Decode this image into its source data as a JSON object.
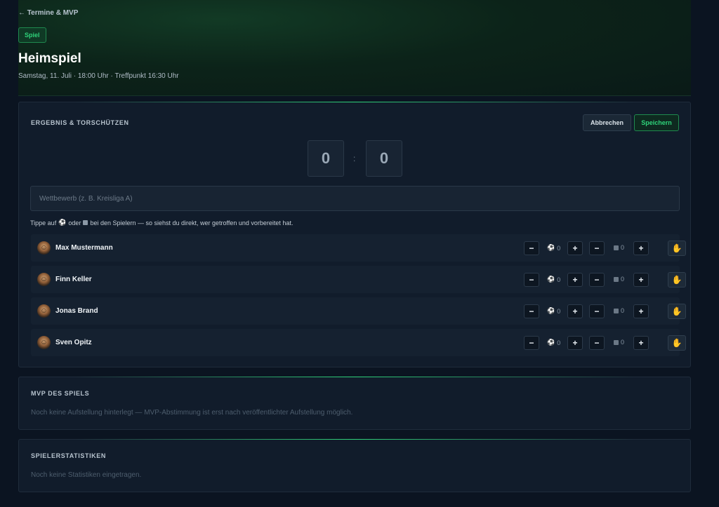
{
  "header": {
    "back_label": "← Termine & MVP",
    "badge": "Spiel",
    "title": "Heimspiel",
    "subtitle": "Samstag, 11. Juli · 18:00 Uhr · Treffpunkt 16:30 Uhr"
  },
  "result": {
    "section_title": "ERGEBNIS & TORSCHÜTZEN",
    "cancel_label": "Abbrechen",
    "save_label": "Speichern",
    "score_home": "0",
    "score_separator": ":",
    "score_away": "0",
    "competition_placeholder": "Wettbewerb (z. B. Kreisliga A)",
    "competition_value": "",
    "hint_part1": "Tippe auf",
    "hint_part2": "oder",
    "hint_part3": "bei den Spielern — so siehst du direkt, wer getroffen und vorbereitet hat.",
    "minus_label": "−",
    "plus_label": "+",
    "players": [
      {
        "name": "Max Mustermann",
        "goals": "0",
        "assists": "0"
      },
      {
        "name": "Finn Keller",
        "goals": "0",
        "assists": "0"
      },
      {
        "name": "Jonas Brand",
        "goals": "0",
        "assists": "0"
      },
      {
        "name": "Sven Opitz",
        "goals": "0",
        "assists": "0"
      }
    ]
  },
  "mvp": {
    "section_title": "MVP DES SPIELS",
    "text": "Noch keine Aufstellung hinterlegt — MVP-Abstimmung ist erst nach veröffentlichter Aufstellung möglich."
  },
  "stats": {
    "section_title": "SPIELERSTATISTIKEN",
    "text": "Noch keine Statistiken eingetragen."
  },
  "icons": {
    "goal": "soccer-ball-icon",
    "assist": "assist-icon",
    "hand": "hand-icon"
  },
  "colors": {
    "accent": "#2fd37a",
    "background": "#0b1421",
    "card": "#111c2b"
  }
}
